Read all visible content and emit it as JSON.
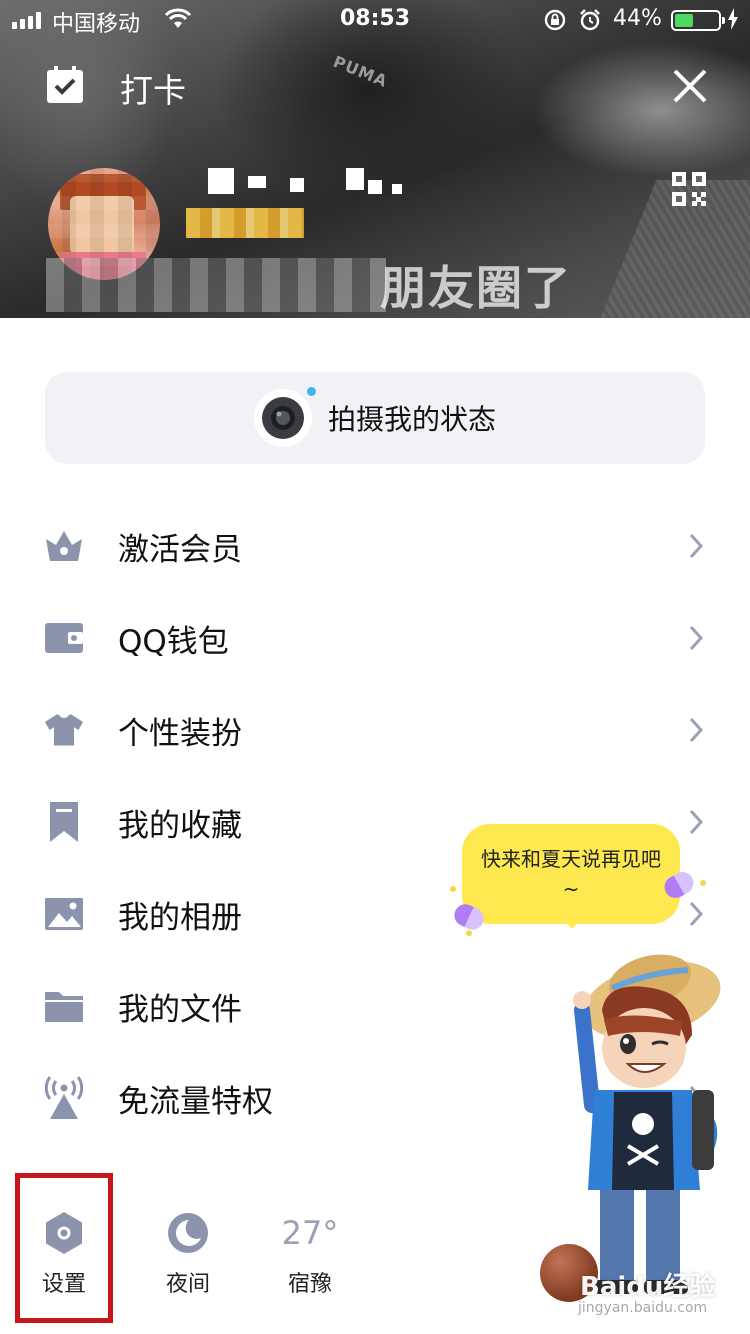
{
  "status_bar": {
    "carrier": "中国移动",
    "time": "08:53",
    "battery_percent": "44%",
    "battery_level": 0.44
  },
  "header": {
    "checkin_label": "打卡",
    "status_text": "朋友圈了"
  },
  "capture": {
    "label": "拍摄我的状态"
  },
  "menu": [
    {
      "label": "激活会员",
      "icon": "crown-icon"
    },
    {
      "label": "QQ钱包",
      "icon": "wallet-icon"
    },
    {
      "label": "个性装扮",
      "icon": "tshirt-icon"
    },
    {
      "label": "我的收藏",
      "icon": "bookmark-icon"
    },
    {
      "label": "我的相册",
      "icon": "photo-icon"
    },
    {
      "label": "我的文件",
      "icon": "folder-icon"
    },
    {
      "label": "免流量特权",
      "icon": "signal-tower-icon"
    }
  ],
  "bubble": {
    "text": "快来和夏天说再见吧~"
  },
  "bottom": {
    "settings_label": "设置",
    "night_label": "夜间",
    "weather_temp": "27°",
    "weather_city": "宿豫"
  },
  "watermark": {
    "brand": "Baidu经验",
    "url": "jingyan.baidu.com"
  },
  "colors": {
    "icon_gray": "#8c93ad",
    "highlight_red": "#c8151b",
    "bubble_yellow": "#fde84f",
    "battery_green": "#4cd964"
  }
}
